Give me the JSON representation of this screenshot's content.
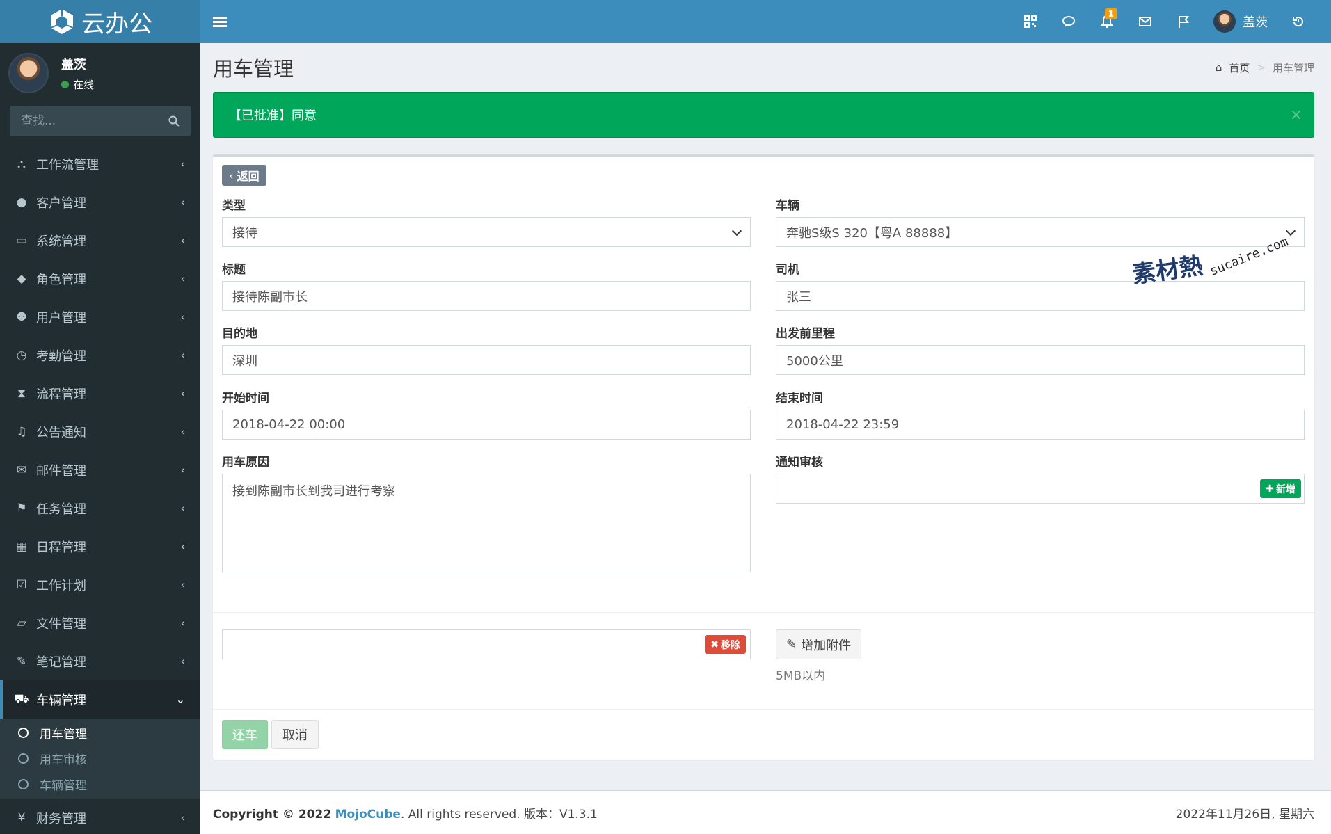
{
  "app": {
    "logo_text": "云办公"
  },
  "user": {
    "name": "盖茨",
    "status": "在线"
  },
  "search": {
    "placeholder": "查找..."
  },
  "sidebar": {
    "items": [
      {
        "label": "工作流管理",
        "icon": "sitemap-icon"
      },
      {
        "label": "客户管理",
        "icon": "user-icon"
      },
      {
        "label": "系统管理",
        "icon": "desktop-icon"
      },
      {
        "label": "角色管理",
        "icon": "graduation-cap-icon"
      },
      {
        "label": "用户管理",
        "icon": "users-icon"
      },
      {
        "label": "考勤管理",
        "icon": "clock-icon"
      },
      {
        "label": "流程管理",
        "icon": "hourglass-icon"
      },
      {
        "label": "公告通知",
        "icon": "bell-icon"
      },
      {
        "label": "邮件管理",
        "icon": "envelope-icon"
      },
      {
        "label": "任务管理",
        "icon": "flag-icon"
      },
      {
        "label": "日程管理",
        "icon": "calendar-icon"
      },
      {
        "label": "工作计划",
        "icon": "calendar-check-icon"
      },
      {
        "label": "文件管理",
        "icon": "folder-open-icon"
      },
      {
        "label": "笔记管理",
        "icon": "edit-icon"
      },
      {
        "label": "车辆管理",
        "icon": "car-icon"
      },
      {
        "label": "财务管理",
        "icon": "yen-icon"
      }
    ],
    "submenu": [
      {
        "label": "用车管理"
      },
      {
        "label": "用车审核"
      },
      {
        "label": "车辆管理"
      }
    ]
  },
  "header": {
    "badge_count": "1",
    "user_name": "盖茨"
  },
  "page": {
    "title": "用车管理",
    "breadcrumb_home": "首页",
    "breadcrumb_current": "用车管理"
  },
  "alert": {
    "text": "【已批准】同意",
    "close": "×"
  },
  "form": {
    "back_label": "返回",
    "type_label": "类型",
    "type_value": "接待",
    "vehicle_label": "车辆",
    "vehicle_value": "奔驰S级S 320【粤A 88888】",
    "title_label": "标题",
    "title_value": "接待陈副市长",
    "driver_label": "司机",
    "driver_value": "张三",
    "destination_label": "目的地",
    "destination_value": "深圳",
    "mileage_label": "出发前里程",
    "mileage_value": "5000公里",
    "start_label": "开始时间",
    "start_value": "2018-04-22 00:00",
    "end_label": "结束时间",
    "end_value": "2018-04-22 23:59",
    "reason_label": "用车原因",
    "reason_value": "接到陈副市长到我司进行考察",
    "notify_label": "通知审核",
    "add_label": "新增",
    "remove_label": "移除",
    "attach_label": "增加附件",
    "attach_hint": "5MB以内",
    "return_label": "还车",
    "cancel_label": "取消"
  },
  "watermark": {
    "cn": "素材熱",
    "en": "sucaire.com"
  },
  "footer": {
    "copyright_prefix": "Copyright © 2022",
    "brand": "MojoCube",
    "rights": ". All rights reserved. 版本：V1.3.1",
    "date": "2022年11月26日, 星期六"
  },
  "colors": {
    "header": "#3c8dbc",
    "sidebar": "#222d32",
    "success": "#00a65a",
    "danger": "#dd4b39"
  }
}
